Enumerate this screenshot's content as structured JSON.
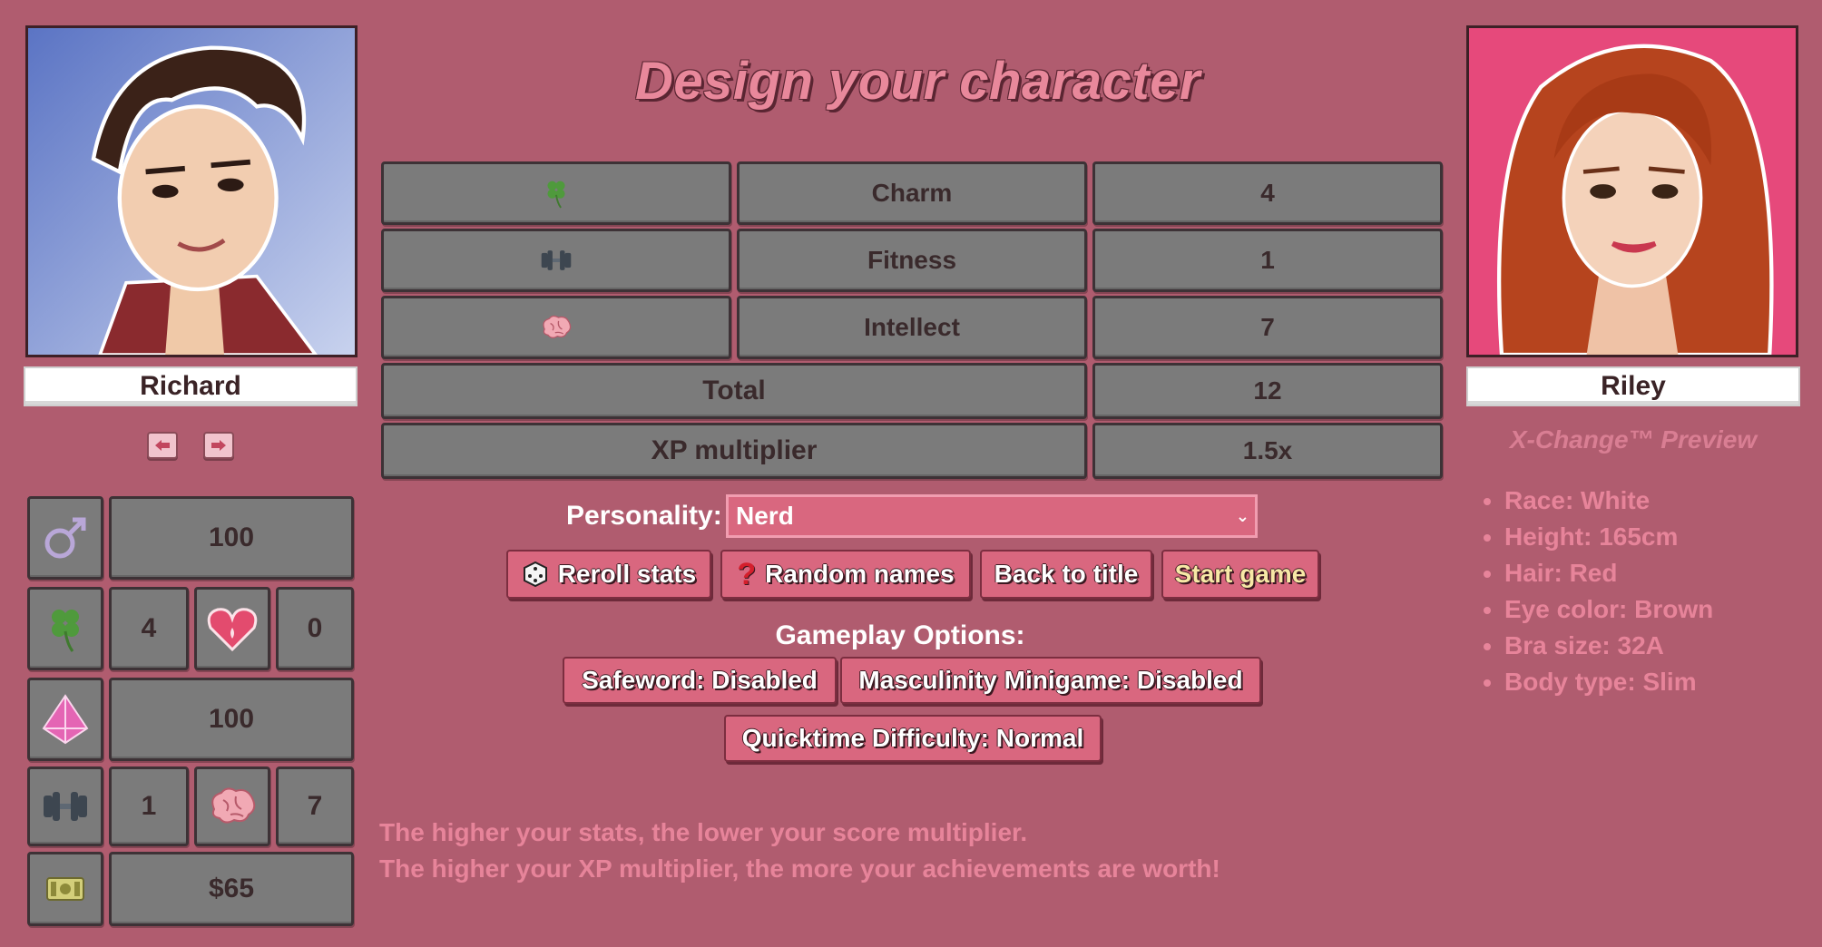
{
  "title": "Design your character",
  "player": {
    "name": "Richard"
  },
  "partner": {
    "name": "Riley"
  },
  "stats_table": {
    "rows": [
      {
        "icon": "clover-icon",
        "label": "Charm",
        "value": "4"
      },
      {
        "icon": "dumbbell-icon",
        "label": "Fitness",
        "value": "1"
      },
      {
        "icon": "brain-icon",
        "label": "Intellect",
        "value": "7"
      }
    ],
    "total_label": "Total",
    "total_value": "12",
    "xp_label": "XP multiplier",
    "xp_value": "1.5x"
  },
  "sidebar": {
    "masculinity": "100",
    "charm": "4",
    "arousal": "0",
    "energy": "100",
    "fitness": "1",
    "intellect": "7",
    "money": "$65"
  },
  "personality": {
    "label": "Personality:",
    "selected": "Nerd"
  },
  "buttons": {
    "reroll": "Reroll stats",
    "random_names": "Random names",
    "back": "Back to title",
    "start": "Start game"
  },
  "gameplay": {
    "heading": "Gameplay Options:",
    "safeword": "Safeword: Disabled",
    "masculinity_minigame": "Masculinity Minigame: Disabled",
    "quicktime": "Quicktime Difficulty: Normal"
  },
  "hints": [
    "The higher your stats, the lower your score multiplier.",
    "The higher your XP multiplier, the more your achievements are worth!"
  ],
  "preview": {
    "title": "X-Change™ Preview",
    "traits": [
      "Race: White",
      "Height: 165cm",
      "Hair: Red",
      "Eye color: Brown",
      "Bra size: 32A",
      "Body type: Slim"
    ]
  },
  "colors": {
    "background": "#b05c6f",
    "button": "#d9677f",
    "cell": "#7b7b7b",
    "hint_text": "#e7849a"
  }
}
